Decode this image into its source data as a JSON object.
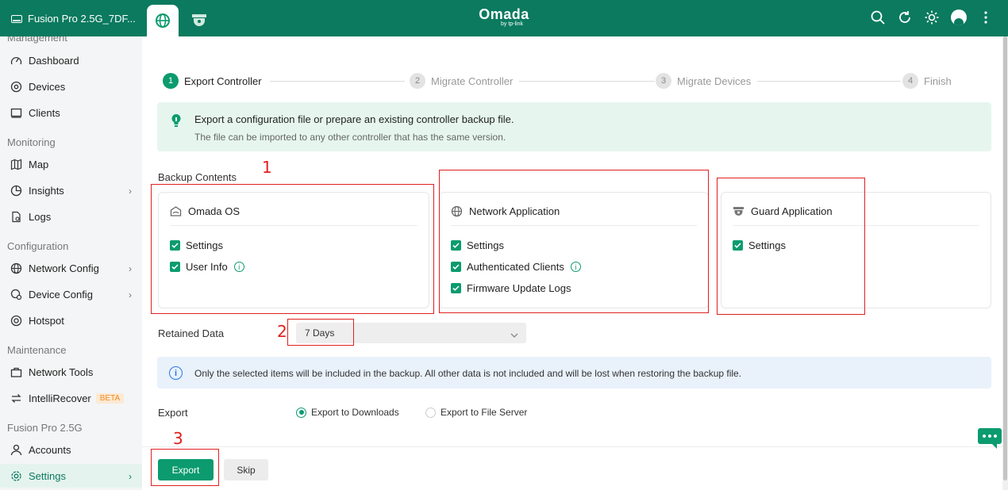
{
  "topbar": {
    "site_name": "Fusion Pro 2.5G_7DF...",
    "brand": "Omada",
    "brand_sub": "by tp-link"
  },
  "sidebar": {
    "cut_section": "Management",
    "sections": {
      "monitoring": "Monitoring",
      "configuration": "Configuration",
      "maintenance": "Maintenance",
      "device": "Fusion Pro 2.5G"
    },
    "items": {
      "dashboard": "Dashboard",
      "devices": "Devices",
      "clients": "Clients",
      "map": "Map",
      "insights": "Insights",
      "logs": "Logs",
      "network_config": "Network Config",
      "device_config": "Device Config",
      "hotspot": "Hotspot",
      "network_tools": "Network Tools",
      "intellirecover": "IntelliRecover",
      "beta": "BETA",
      "accounts": "Accounts",
      "settings": "Settings"
    }
  },
  "steps": [
    {
      "num": "1",
      "label": "Export Controller"
    },
    {
      "num": "2",
      "label": "Migrate Controller"
    },
    {
      "num": "3",
      "label": "Migrate Devices"
    },
    {
      "num": "4",
      "label": "Finish"
    }
  ],
  "tip": {
    "title": "Export a configuration file or prepare an existing controller backup file.",
    "desc": "The file can be imported to any other controller that has the same version."
  },
  "backup": {
    "label": "Backup Contents",
    "omada_os": {
      "title": "Omada OS",
      "items": [
        "Settings",
        "User Info"
      ]
    },
    "network_app": {
      "title": "Network Application",
      "items": [
        "Settings",
        "Authenticated Clients",
        "Firmware Update Logs"
      ]
    },
    "guard_app": {
      "title": "Guard Application",
      "items": [
        "Settings"
      ]
    }
  },
  "retained": {
    "label": "Retained Data",
    "value": "7 Days"
  },
  "notice": "Only the selected items will be included in the backup. All other data is not included and will be lost when restoring the backup file.",
  "export": {
    "label": "Export",
    "option_downloads": "Export to Downloads",
    "option_file_server": "Export to File Server",
    "selected": "Export to Downloads"
  },
  "buttons": {
    "export": "Export",
    "skip": "Skip"
  },
  "annotations": [
    "1",
    "2",
    "3"
  ],
  "colors": {
    "brand_green": "#0b7a5f",
    "accent": "#0b9b6e",
    "annotation": "#e02020"
  }
}
